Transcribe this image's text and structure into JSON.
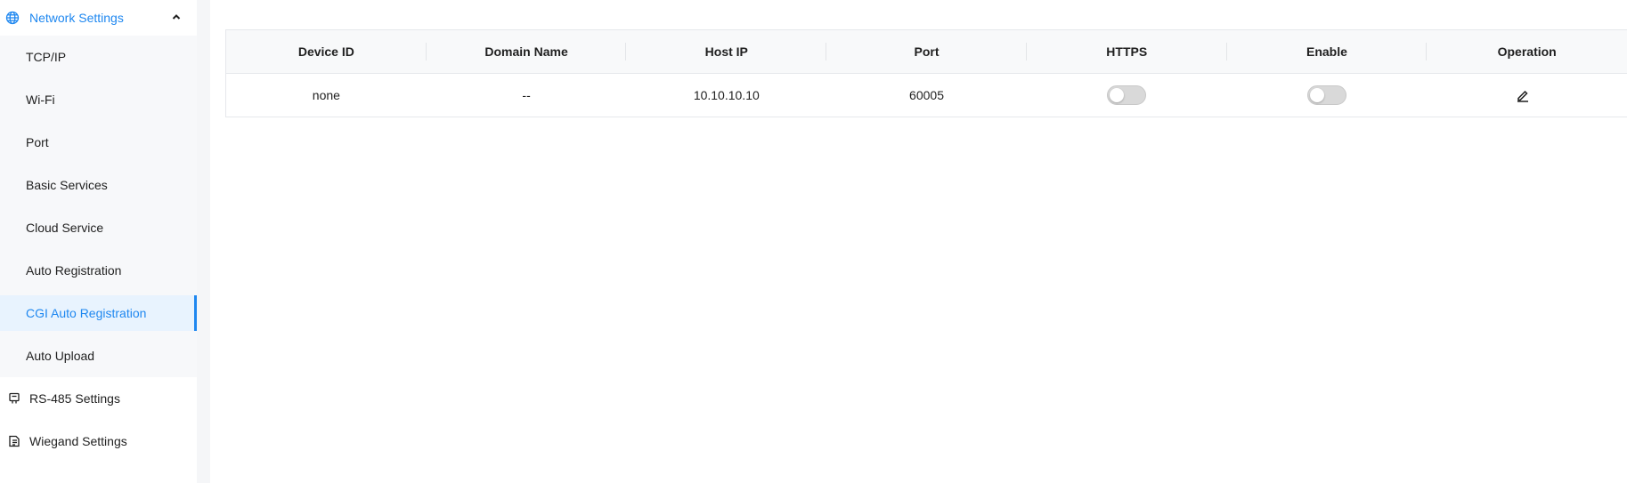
{
  "sidebar": {
    "network_settings": {
      "label": "Network Settings",
      "icon": "globe-icon",
      "expanded": true,
      "items": [
        {
          "label": "TCP/IP"
        },
        {
          "label": "Wi-Fi"
        },
        {
          "label": "Port"
        },
        {
          "label": "Basic Services"
        },
        {
          "label": "Cloud Service"
        },
        {
          "label": "Auto Registration"
        },
        {
          "label": "CGI Auto Registration",
          "active": true
        },
        {
          "label": "Auto Upload"
        }
      ]
    },
    "rs485": {
      "label": "RS-485 Settings",
      "icon": "serial-port-icon"
    },
    "wiegand": {
      "label": "Wiegand Settings",
      "icon": "wiegand-icon"
    }
  },
  "table": {
    "headers": [
      "Device ID",
      "Domain Name",
      "Host IP",
      "Port",
      "HTTPS",
      "Enable",
      "Operation"
    ],
    "rows": [
      {
        "device_id": "none",
        "domain_name": "--",
        "host_ip": "10.10.10.10",
        "port": "60005",
        "https": false,
        "enable": false,
        "operation_icon": "edit-icon"
      }
    ]
  },
  "colors": {
    "accent": "#1e87f0",
    "active_bg": "#e8f3fe",
    "toggle_off": "#d9d9d9"
  }
}
